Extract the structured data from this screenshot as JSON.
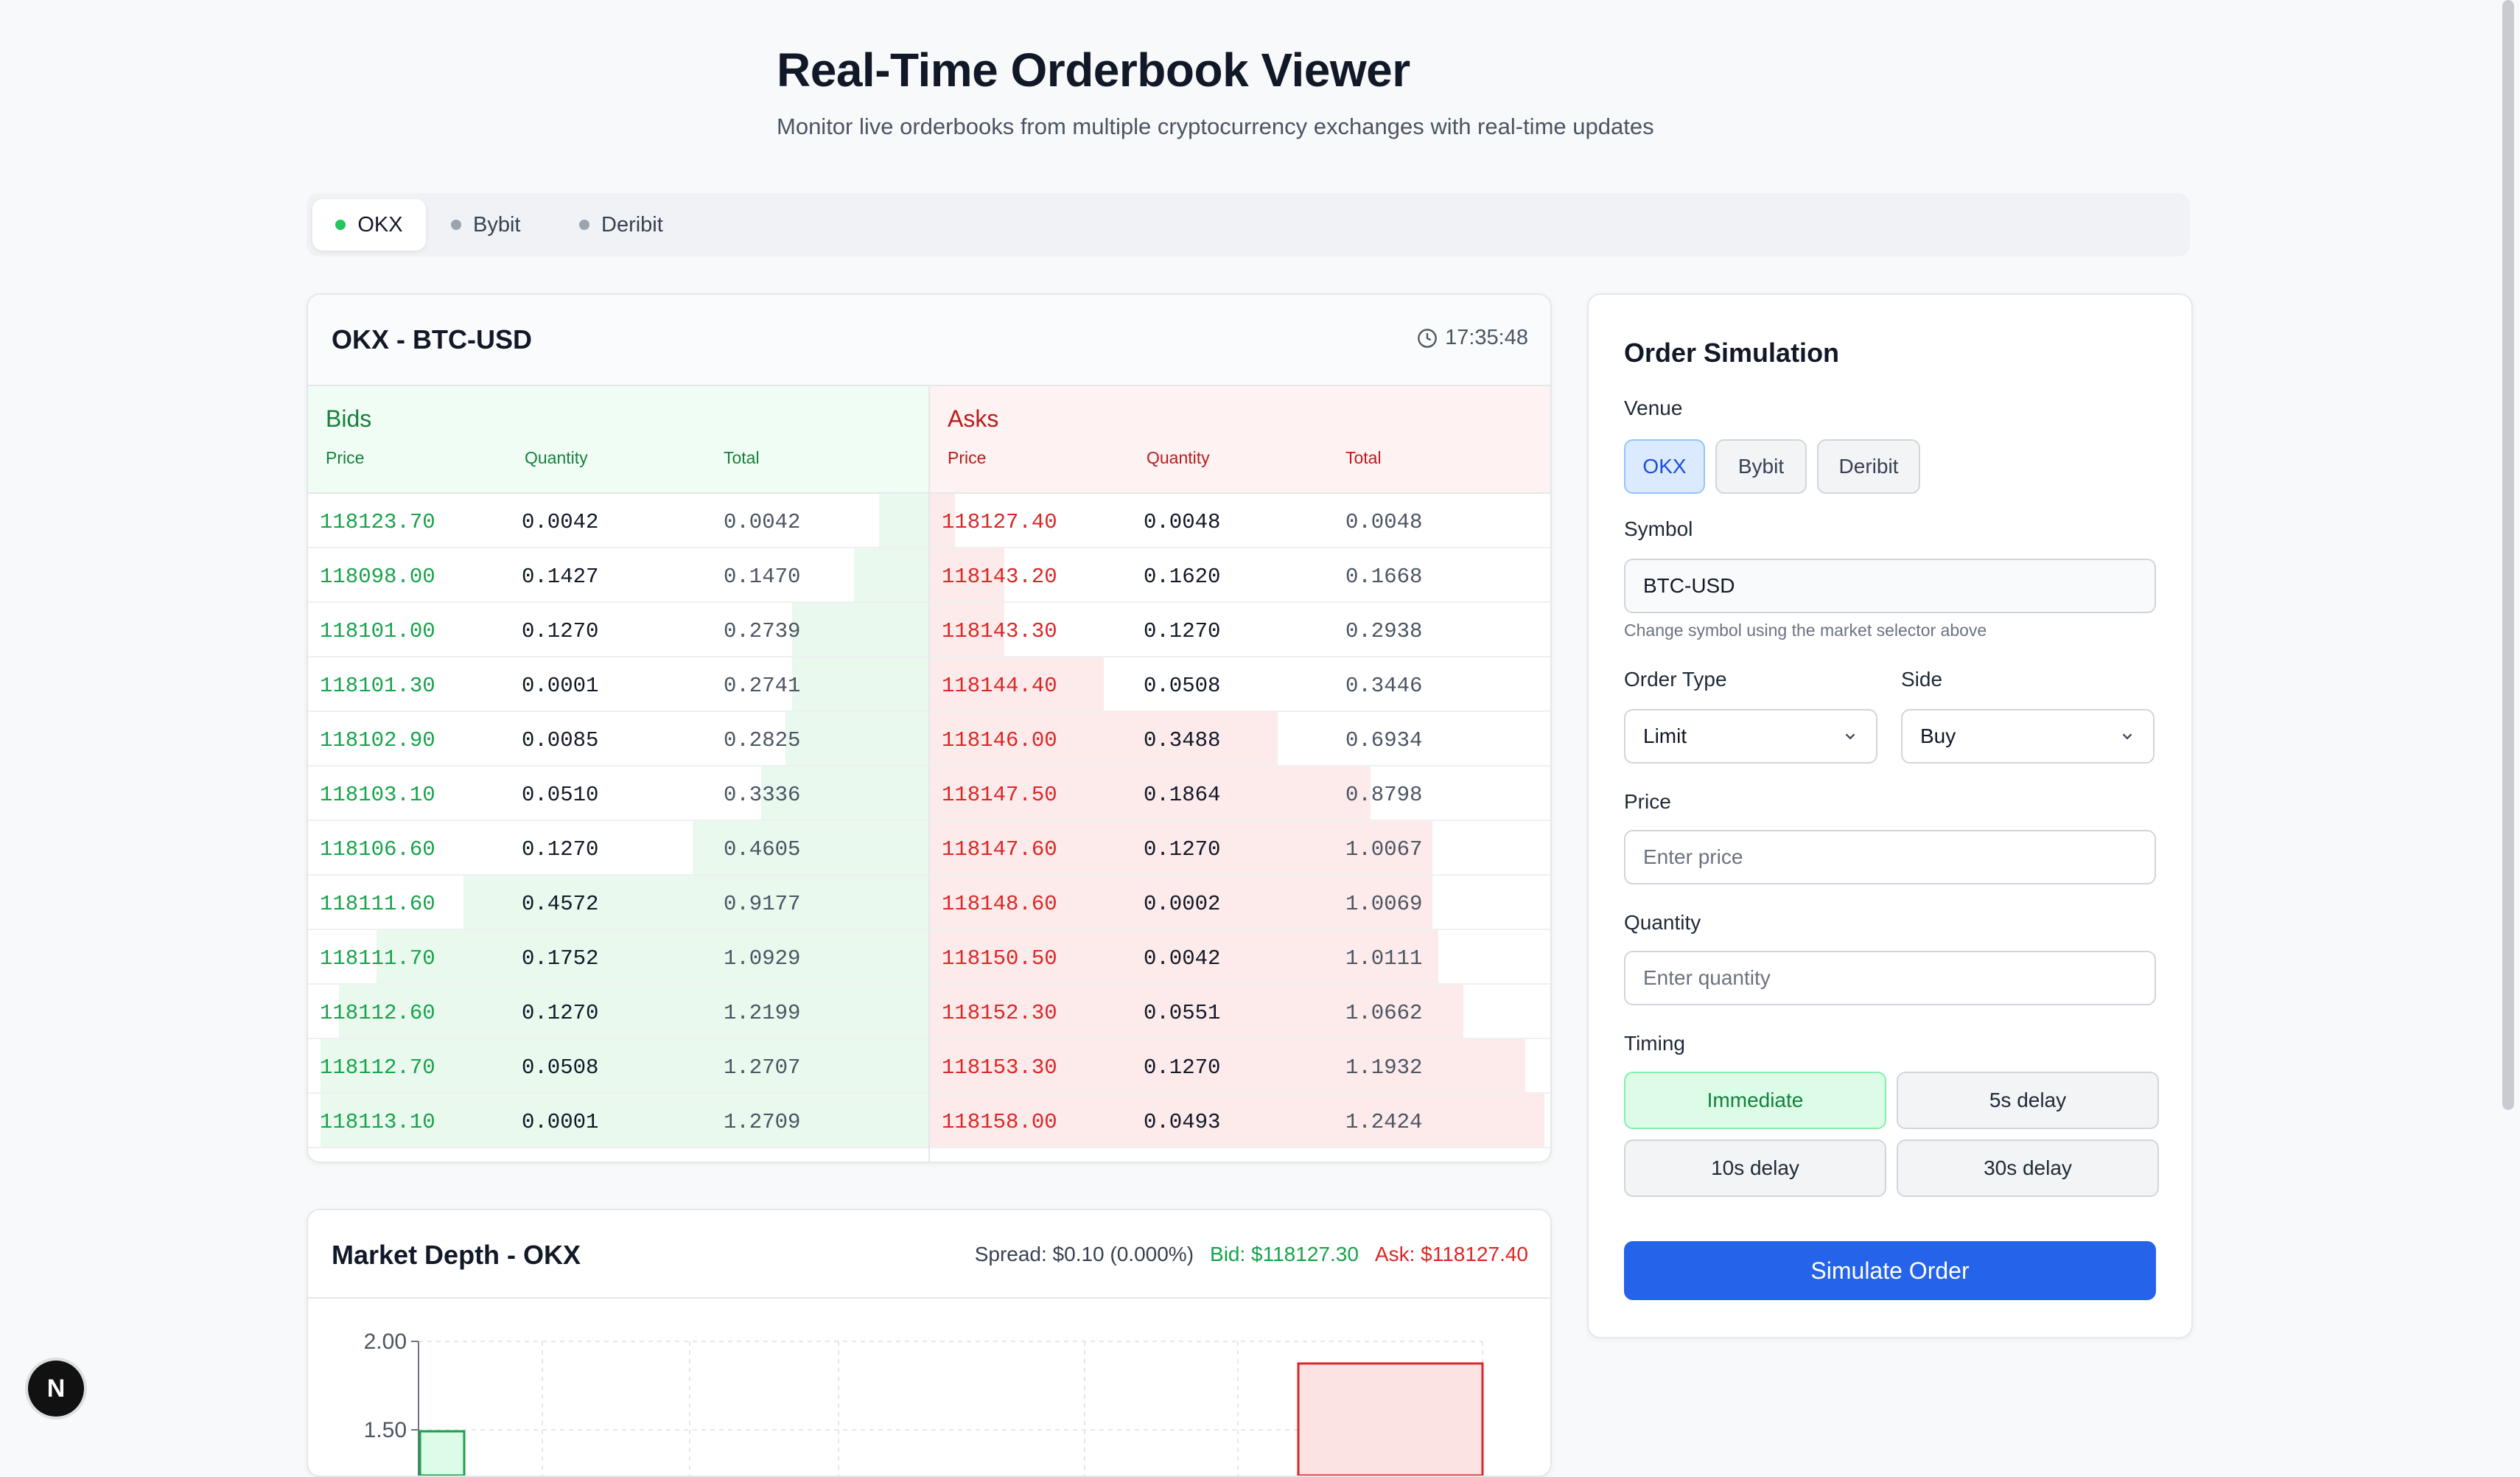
{
  "header": {
    "title": "Real-Time Orderbook Viewer",
    "subtitle": "Monitor live orderbooks from multiple cryptocurrency exchanges with real-time updates"
  },
  "tabs": [
    {
      "label": "OKX",
      "active": true
    },
    {
      "label": "Bybit",
      "active": false
    },
    {
      "label": "Deribit",
      "active": false
    }
  ],
  "orderbook": {
    "title": "OKX - BTC-USD",
    "time": "17:35:48",
    "bids": {
      "title": "Bids",
      "columns": [
        "Price",
        "Quantity",
        "Total"
      ],
      "rows": [
        {
          "price": "118123.70",
          "qty": "0.0042",
          "total": "0.0042",
          "depth": 0.08
        },
        {
          "price": "118098.00",
          "qty": "0.1427",
          "total": "0.1470",
          "depth": 0.12
        },
        {
          "price": "118101.00",
          "qty": "0.1270",
          "total": "0.2739",
          "depth": 0.22
        },
        {
          "price": "118101.30",
          "qty": "0.0001",
          "total": "0.2741",
          "depth": 0.22
        },
        {
          "price": "118102.90",
          "qty": "0.0085",
          "total": "0.2825",
          "depth": 0.23
        },
        {
          "price": "118103.10",
          "qty": "0.0510",
          "total": "0.3336",
          "depth": 0.27
        },
        {
          "price": "118106.60",
          "qty": "0.1270",
          "total": "0.4605",
          "depth": 0.38
        },
        {
          "price": "118111.60",
          "qty": "0.4572",
          "total": "0.9177",
          "depth": 0.75
        },
        {
          "price": "118111.70",
          "qty": "0.1752",
          "total": "1.0929",
          "depth": 0.89
        },
        {
          "price": "118112.60",
          "qty": "0.1270",
          "total": "1.2199",
          "depth": 0.95
        },
        {
          "price": "118112.70",
          "qty": "0.0508",
          "total": "1.2707",
          "depth": 0.98
        },
        {
          "price": "118113.10",
          "qty": "0.0001",
          "total": "1.2709",
          "depth": 0.98
        }
      ]
    },
    "asks": {
      "title": "Asks",
      "columns": [
        "Price",
        "Quantity",
        "Total"
      ],
      "rows": [
        {
          "price": "118127.40",
          "qty": "0.0048",
          "total": "0.0048",
          "depth": 0.04
        },
        {
          "price": "118143.20",
          "qty": "0.1620",
          "total": "0.1668",
          "depth": 0.12
        },
        {
          "price": "118143.30",
          "qty": "0.1270",
          "total": "0.2938",
          "depth": 0.12
        },
        {
          "price": "118144.40",
          "qty": "0.0508",
          "total": "0.3446",
          "depth": 0.28
        },
        {
          "price": "118146.00",
          "qty": "0.3488",
          "total": "0.6934",
          "depth": 0.56
        },
        {
          "price": "118147.50",
          "qty": "0.1864",
          "total": "0.8798",
          "depth": 0.71
        },
        {
          "price": "118147.60",
          "qty": "0.1270",
          "total": "1.0067",
          "depth": 0.81
        },
        {
          "price": "118148.60",
          "qty": "0.0002",
          "total": "1.0069",
          "depth": 0.81
        },
        {
          "price": "118150.50",
          "qty": "0.0042",
          "total": "1.0111",
          "depth": 0.82
        },
        {
          "price": "118152.30",
          "qty": "0.0551",
          "total": "1.0662",
          "depth": 0.86
        },
        {
          "price": "118153.30",
          "qty": "0.1270",
          "total": "1.1932",
          "depth": 0.96
        },
        {
          "price": "118158.00",
          "qty": "0.0493",
          "total": "1.2424",
          "depth": 0.99
        }
      ]
    }
  },
  "market_depth": {
    "title": "Market Depth - OKX",
    "spread": "Spread: $0.10 (0.000%)",
    "bid": "Bid: $118127.30",
    "ask": "Ask: $118127.40",
    "colors": {
      "bid": "#16a34a",
      "ask": "#dc2626"
    },
    "y_ticks": [
      "2.00",
      "1.50"
    ]
  },
  "order_sim": {
    "title": "Order Simulation",
    "venue_label": "Venue",
    "venues": [
      "OKX",
      "Bybit",
      "Deribit"
    ],
    "symbol_label": "Symbol",
    "symbol_value": "BTC-USD",
    "symbol_hint": "Change symbol using the market selector above",
    "order_type_label": "Order Type",
    "order_type_value": "Limit",
    "side_label": "Side",
    "side_value": "Buy",
    "price_label": "Price",
    "price_placeholder": "Enter price",
    "quantity_label": "Quantity",
    "quantity_placeholder": "Enter quantity",
    "timing_label": "Timing",
    "timing_options": [
      "Immediate",
      "5s delay",
      "10s delay",
      "30s delay"
    ],
    "submit_label": "Simulate Order"
  },
  "badge": {
    "letter": "N"
  }
}
